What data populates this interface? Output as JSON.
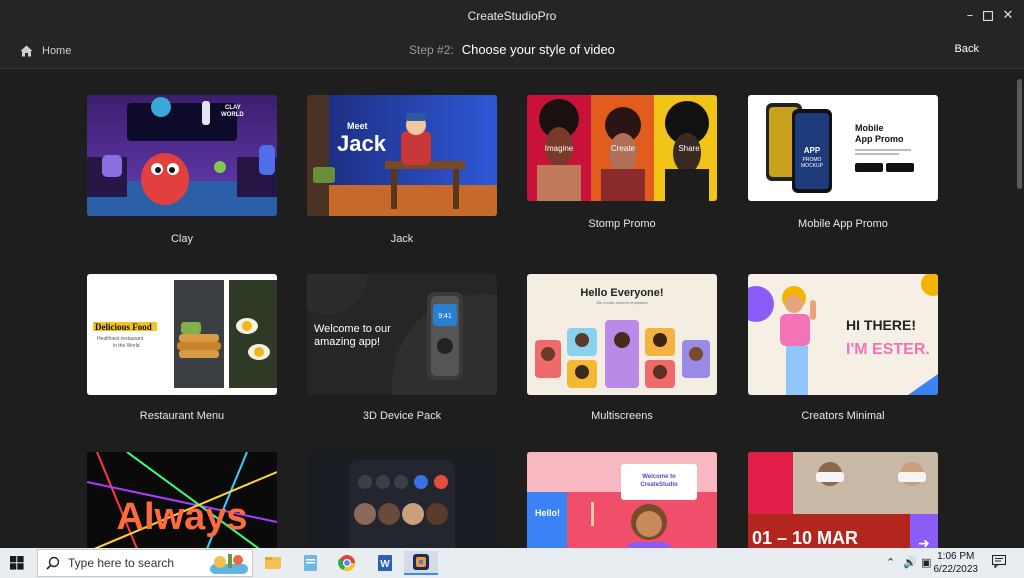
{
  "window": {
    "title": "CreateStudioPro"
  },
  "header": {
    "home_label": "Home",
    "step_prefix": "Step #2:",
    "step_title": "Choose your style of video",
    "back_label": "Back"
  },
  "templates": [
    {
      "name": "Clay",
      "thumb_text": [
        "CLAY",
        "WORLD"
      ]
    },
    {
      "name": "Jack",
      "thumb_text": [
        "Meet",
        "Jack"
      ]
    },
    {
      "name": "Stomp Promo",
      "thumb_text": [
        "Imagine",
        "Create",
        "Share"
      ]
    },
    {
      "name": "Mobile App Promo",
      "thumb_text": [
        "Mobile",
        "App Promo",
        "APP",
        "PROMO",
        "MOCKUP"
      ]
    },
    {
      "name": "Restaurant Menu",
      "thumb_text": [
        "Delicious Food",
        "Healthiest restaurant",
        "in the World"
      ]
    },
    {
      "name": "3D Device Pack",
      "thumb_text": [
        "Welcome to our",
        "amazing app!",
        "9:41"
      ]
    },
    {
      "name": "Multiscreens",
      "thumb_text": [
        "Hello Everyone!",
        "We create modern templates"
      ]
    },
    {
      "name": "Creators Minimal",
      "thumb_text": [
        "HI THERE!",
        "I'M ESTER."
      ]
    },
    {
      "name": "",
      "thumb_text": [
        "Always"
      ]
    },
    {
      "name": "",
      "thumb_text": []
    },
    {
      "name": "",
      "thumb_text": [
        "Hello!",
        "Welcome to",
        "CreateStudio"
      ]
    },
    {
      "name": "",
      "thumb_text": [
        "01 – 10 MAR"
      ]
    }
  ],
  "taskbar": {
    "search_placeholder": "Type here to search",
    "time": "1:06 PM",
    "date": "6/22/2023"
  },
  "icons": [
    "home-icon",
    "minimize-icon",
    "maximize-icon",
    "close-icon",
    "windows-start-icon",
    "search-icon",
    "file-explorer-icon",
    "notepad-icon",
    "chrome-icon",
    "word-icon",
    "createstudio-icon",
    "chevron-up-icon",
    "volume-icon",
    "network-icon",
    "notification-icon"
  ]
}
